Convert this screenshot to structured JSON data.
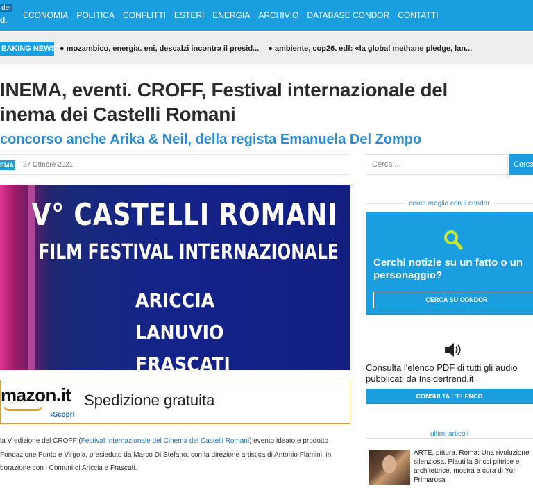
{
  "nav": {
    "logo_top": "der",
    "logo_bottom": "d.",
    "items": [
      "ECONOMIA",
      "POLITICA",
      "CONFLITTI",
      "ESTERI",
      "ENERGIA",
      "ARCHIVIO",
      "DATABASE CONDOR",
      "CONTATTI"
    ]
  },
  "breaking": {
    "label": "EAKING NEWS",
    "items": [
      "● mozambico, energia. eni, descalzi incontra il presid...",
      "● ambiente, cop26. edf: «la global methane pledge, lan..."
    ]
  },
  "article": {
    "headline": "INEMA, eventi. CROFF, Festival internazionale del inema dei Castelli Romani",
    "subtitle": "concorso anche Arika & Neil, della regista Emanuela Del Zompo",
    "category": "EMA",
    "date": "27 Ottobre 2021",
    "hero": {
      "line1": "V° CASTELLI ROMANI",
      "line2": "FILM FESTIVAL INTERNAZIONALE",
      "line3": "ARICCIA",
      "line4": "LANUVIO",
      "line5": "FRASCATI"
    },
    "body_1": "la V edizione del CROFF (",
    "body_link": "Festival Internazionale del Cinema dei Castelli Romani",
    "body_2": ") evento ideato e prodotto",
    "body_3": "Fondazione Punto e Virgola, presieduto da Marco Di Stefano, con la direzione artistica di Antonio Flamini, in",
    "body_4": "borazione con i Comuni di Ariccia e Frascati."
  },
  "ad": {
    "brand": "mazon.it",
    "link": "›Scopri",
    "text": "Spedizione gratuita"
  },
  "sidebar": {
    "search_placeholder": "Cerca ...",
    "search_button": "Cerca",
    "condor_section": "cerca meglio con il condor",
    "condor_question": "Cerchi notizie su un fatto o un personaggio?",
    "condor_button": "CERCA SU CONDOR",
    "pdf_text": "Consulta l'elenco PDF di tutti gli audio pubblicati da Insidertrend.it",
    "pdf_button": "CONSULTA L'ELENCO",
    "recent_section": "ultimi articoli",
    "recent_article": "ARTE, pittura. Roma: Una rivoluzione silenziosa. Plautilla Bricci pittrice e architettrice, mostra a cura di Yuri Primarosa"
  },
  "colors": {
    "accent": "#1a9ee0",
    "link": "#2a8cd6"
  }
}
